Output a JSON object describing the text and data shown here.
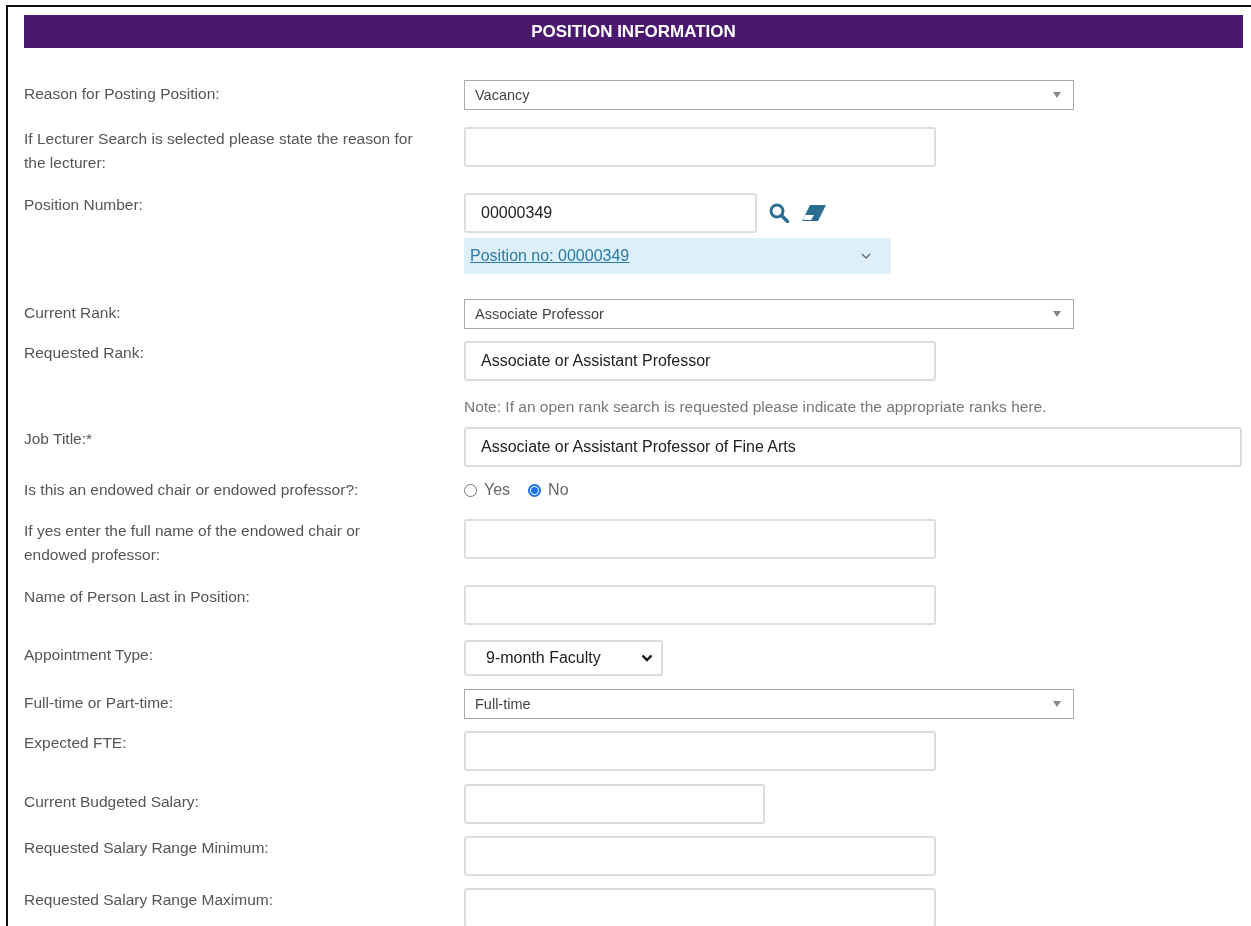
{
  "section": {
    "title": "POSITION INFORMATION"
  },
  "fields": [
    {
      "kind": "dropdown",
      "label": "Reason for Posting Position:",
      "value": "Vacancy"
    },
    {
      "kind": "text",
      "label": "If Lecturer Search is selected please state the reason for the lecturer:"
    },
    {
      "kind": "lookup",
      "label": "Position Number:",
      "value": "00000349",
      "result": "Position no: 00000349"
    },
    {
      "kind": "dropdown",
      "label": "Current Rank:",
      "value": "Associate Professor"
    },
    {
      "kind": "text",
      "label": "Requested Rank:",
      "value": "Associate or Assistant Professor",
      "note": "Note: If an open rank search is requested please indicate the appropriate ranks here."
    },
    {
      "kind": "wide_text",
      "label": "Job Title:*",
      "value": "Associate or Assistant Professor of Fine Arts"
    },
    {
      "kind": "radio",
      "label": "Is this an endowed chair or endowed professor?:",
      "options": [
        {
          "label": "Yes",
          "selected": false
        },
        {
          "label": "No",
          "selected": true
        }
      ]
    },
    {
      "kind": "text",
      "label": "If yes enter the full name of the endowed chair or endowed professor:"
    },
    {
      "kind": "text",
      "label": "Name of Person Last in Position:"
    },
    {
      "kind": "native_select",
      "label": "Appointment Type:",
      "value": "9-month Faculty"
    },
    {
      "kind": "dropdown",
      "label": "Full-time or Part-time:",
      "value": "Full-time"
    },
    {
      "kind": "text",
      "label": "Expected FTE:"
    },
    {
      "kind": "short_text",
      "label": "Current Budgeted Salary:"
    },
    {
      "kind": "text",
      "label": "Requested Salary Range Minimum:"
    },
    {
      "kind": "text",
      "label": "Requested Salary Range Maximum:"
    }
  ]
}
